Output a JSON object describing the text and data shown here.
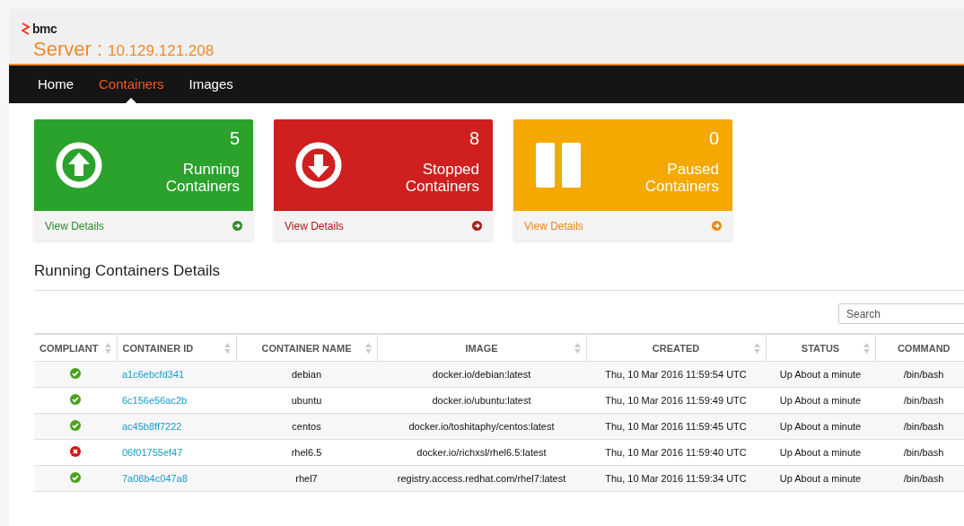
{
  "brand": {
    "logo": "bmc",
    "server_label": "Server :",
    "server_address": "10.129.121.208"
  },
  "nav": [
    {
      "label": "Home",
      "selected": false
    },
    {
      "label": "Containers",
      "selected": true
    },
    {
      "label": "Images",
      "selected": false
    }
  ],
  "cards": [
    {
      "kind": "running",
      "count": "5",
      "title": "Running Containers",
      "link": "View Details"
    },
    {
      "kind": "stopped",
      "count": "8",
      "title": "Stopped Containers",
      "link": "View Details"
    },
    {
      "kind": "paused",
      "count": "0",
      "title": "Paused Containers",
      "link": "View Details"
    }
  ],
  "section_title": "Running Containers Details",
  "search": {
    "placeholder": "Search"
  },
  "table": {
    "columns": [
      "COMPLIANT",
      "CONTAINER ID",
      "CONTAINER NAME",
      "IMAGE",
      "CREATED",
      "STATUS",
      "COMMAND"
    ],
    "rows": [
      {
        "compliant": true,
        "id": "a1c6ebcfd341",
        "name": "debian",
        "image": "docker.io/debian:latest",
        "created": "Thu, 10 Mar 2016 11:59:54 UTC",
        "status": "Up About a minute",
        "command": "/bin/bash"
      },
      {
        "compliant": true,
        "id": "6c156e56ac2b",
        "name": "ubuntu",
        "image": "docker.io/ubuntu:latest",
        "created": "Thu, 10 Mar 2016 11:59:49 UTC",
        "status": "Up About a minute",
        "command": "/bin/bash"
      },
      {
        "compliant": true,
        "id": "ac45b8ff7222",
        "name": "centos",
        "image": "docker.io/toshitaphy/centos:latest",
        "created": "Thu, 10 Mar 2016 11:59:45 UTC",
        "status": "Up About a minute",
        "command": "/bin/bash"
      },
      {
        "compliant": false,
        "id": "06f01755ef47",
        "name": "rhel6.5",
        "image": "docker.io/richxsl/rhel6.5:latest",
        "created": "Thu, 10 Mar 2016 11:59:40 UTC",
        "status": "Up About a minute",
        "command": "/bin/bash"
      },
      {
        "compliant": true,
        "id": "7a08b4c047a8",
        "name": "rhel7",
        "image": "registry.access.redhat.com/rhel7:latest",
        "created": "Thu, 10 Mar 2016 11:59:34 UTC",
        "status": "Up About a minute",
        "command": "/bin/bash"
      }
    ]
  }
}
